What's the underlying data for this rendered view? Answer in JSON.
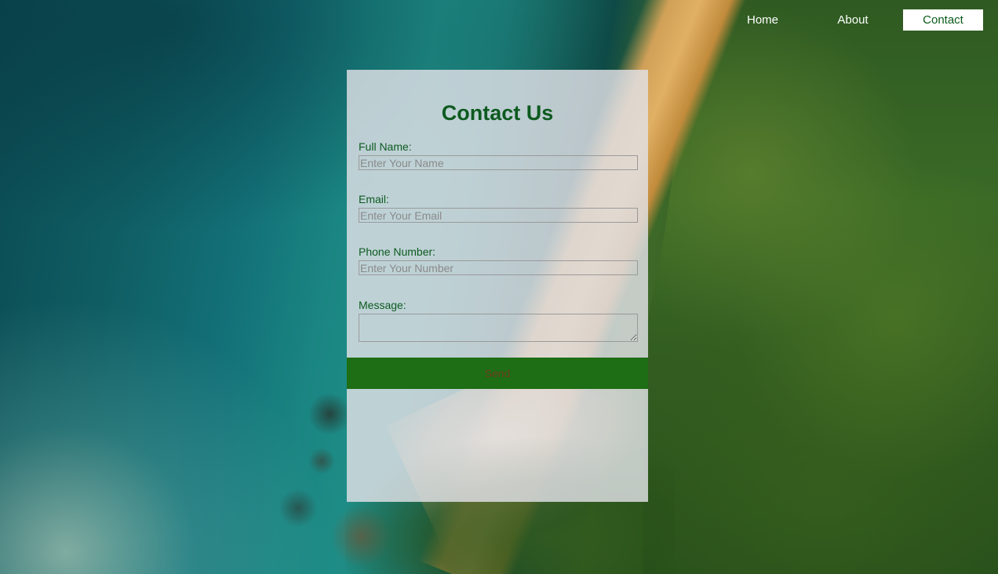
{
  "nav": {
    "items": [
      {
        "label": "Home",
        "active": false
      },
      {
        "label": "About",
        "active": false
      },
      {
        "label": "Contact",
        "active": true
      }
    ]
  },
  "form": {
    "title": "Contact Us",
    "fields": {
      "name": {
        "label": "Full Name:",
        "placeholder": "Enter Your Name",
        "value": ""
      },
      "email": {
        "label": "Email:",
        "placeholder": "Enter Your Email",
        "value": ""
      },
      "phone": {
        "label": "Phone Number:",
        "placeholder": "Enter Your Number",
        "value": ""
      },
      "message": {
        "label": "Message:",
        "value": ""
      }
    },
    "submit_label": "Send"
  },
  "colors": {
    "accent_green": "#0d5a1f",
    "button_green": "#1d6e14",
    "card_background": "#e2e2e8"
  }
}
